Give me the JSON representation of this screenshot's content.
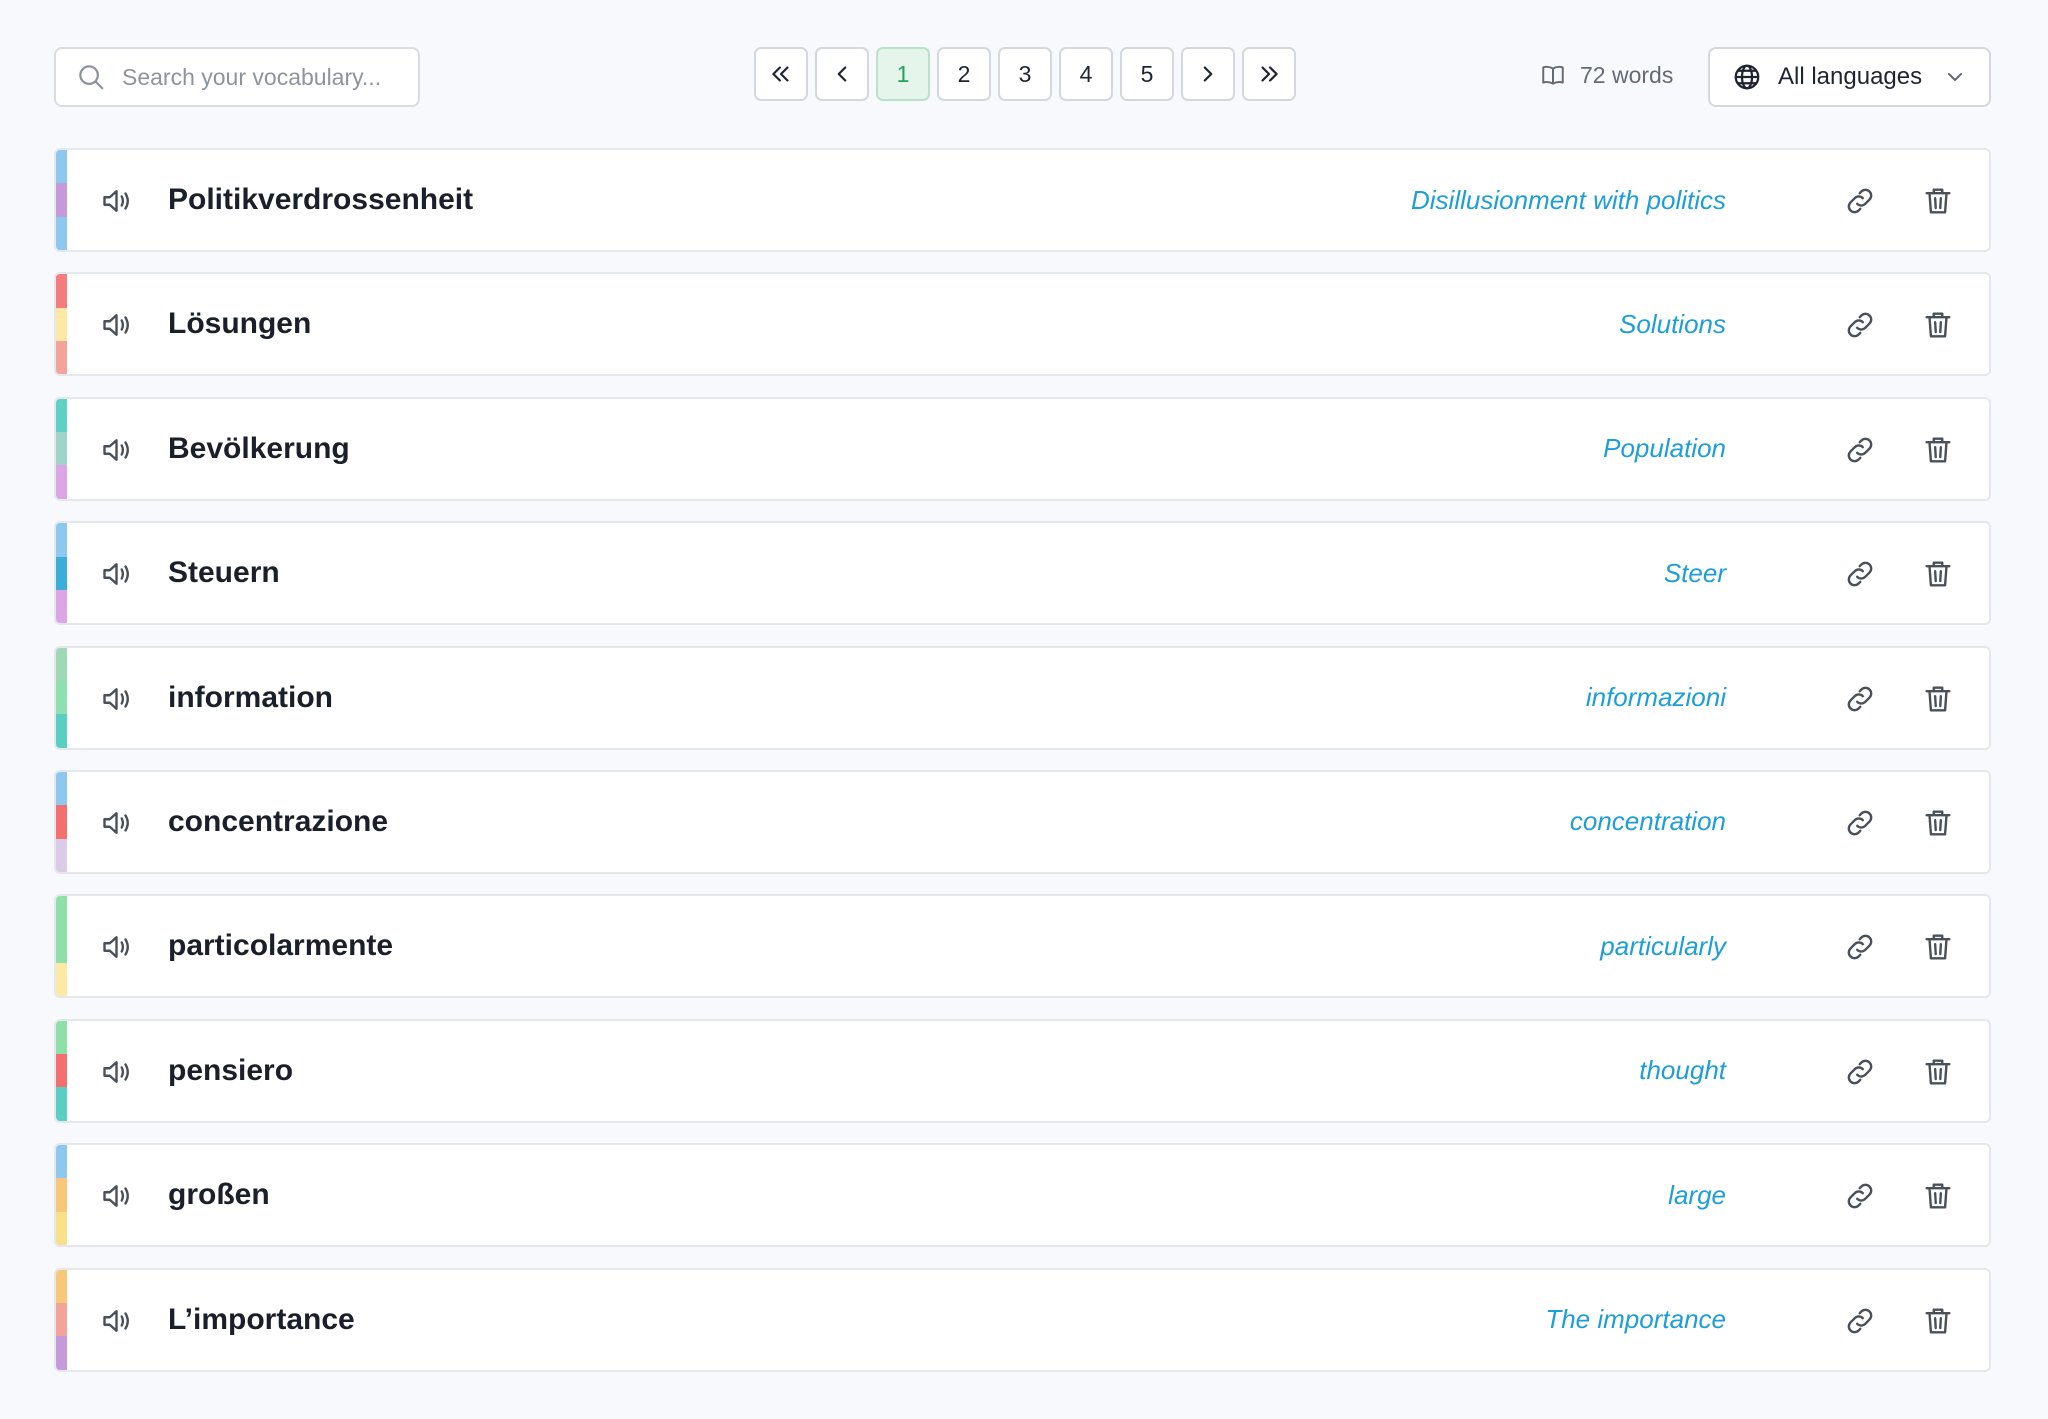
{
  "search": {
    "placeholder": "Search your vocabulary..."
  },
  "pagination": {
    "pages": [
      "1",
      "2",
      "3",
      "4",
      "5"
    ],
    "current": "1"
  },
  "word_count": "72 words",
  "language_filter": {
    "selected": "All languages"
  },
  "colors": {
    "accent_link": "#1e9ed8",
    "active_page_bg": "#e6f5ec",
    "active_page_text": "#20a35a"
  },
  "words": [
    {
      "word": "Politikverdrossenheit",
      "translation": "Disillusionment with politics",
      "stripe": [
        "#8ec8ee",
        "#c59ad8",
        "#8ec8ee"
      ]
    },
    {
      "word": "Lösungen",
      "translation": "Solutions",
      "stripe": [
        "#f47c7c",
        "#fde9a4",
        "#f3a39a"
      ]
    },
    {
      "word": "Bevölkerung",
      "translation": "Population",
      "stripe": [
        "#5fd0c4",
        "#9fd5c9",
        "#dca6e6"
      ]
    },
    {
      "word": "Steuern",
      "translation": "Steer",
      "stripe": [
        "#8ec8ee",
        "#3aaed8",
        "#dca6e6"
      ]
    },
    {
      "word": "information",
      "translation": "informazioni",
      "stripe": [
        "#9fd8b4",
        "#8fe0b0",
        "#58cfc2"
      ]
    },
    {
      "word": "concentrazione",
      "translation": "concentration",
      "stripe": [
        "#8ec8ee",
        "#f47070",
        "#dccbe6"
      ]
    },
    {
      "word": "particolarmente",
      "translation": "particularly",
      "stripe": [
        "#8fe0a8",
        "#8fe0a8",
        "#fde9a4"
      ]
    },
    {
      "word": "pensiero",
      "translation": "thought",
      "stripe": [
        "#8fe0a8",
        "#f47070",
        "#58cfc2"
      ]
    },
    {
      "word": "großen",
      "translation": "large",
      "stripe": [
        "#8ec8ee",
        "#f8c77a",
        "#fbe08a"
      ]
    },
    {
      "word": "L’importance",
      "translation": "The importance",
      "stripe": [
        "#f8c77a",
        "#f3a39a",
        "#c59ad8"
      ]
    }
  ]
}
